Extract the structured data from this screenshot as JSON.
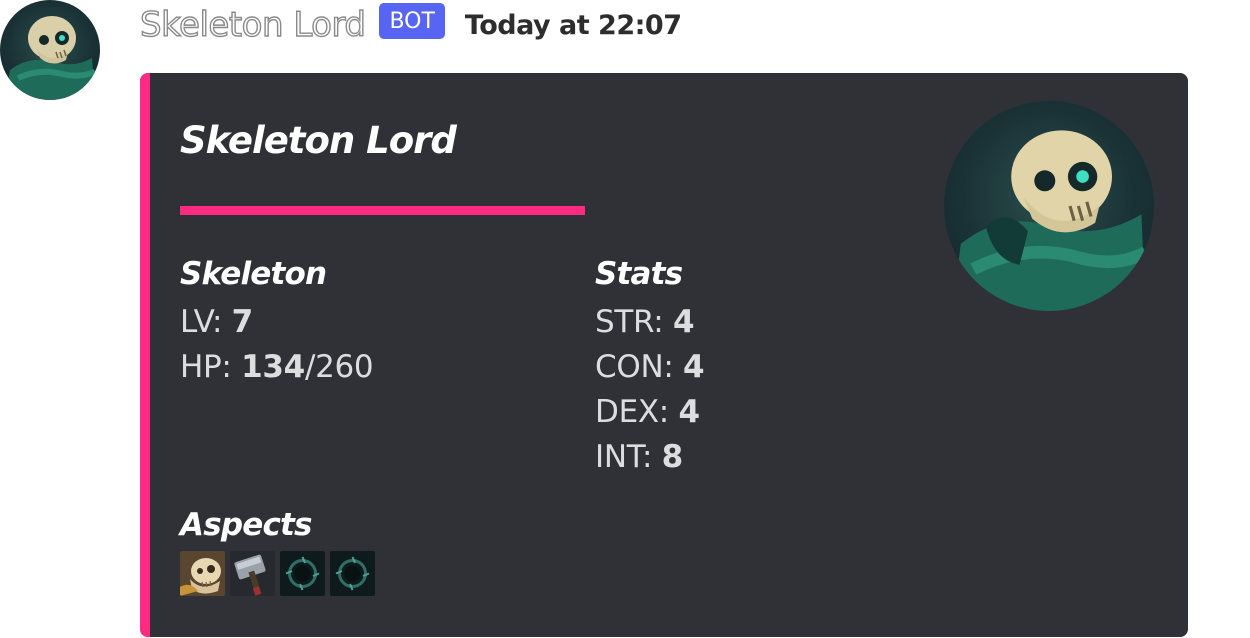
{
  "message": {
    "author": "Skeleton Lord",
    "bot_tag": "BOT",
    "timestamp": "Today at 22:07",
    "avatar_icon": "skull-avatar-icon"
  },
  "embed": {
    "accent_color": "#ff2a82",
    "title": "Skeleton Lord",
    "thumbnail_icon": "skull-thumbnail-icon",
    "fields": {
      "skeleton": {
        "name": "Skeleton",
        "lv_label": "LV:",
        "lv_value": "7",
        "hp_label": "HP:",
        "hp_current": "134",
        "hp_max": "/260"
      },
      "stats": {
        "name": "Stats",
        "str_label": "STR:",
        "str_value": "4",
        "con_label": "CON:",
        "con_value": "4",
        "dex_label": "DEX:",
        "dex_value": "4",
        "int_label": "INT:",
        "int_value": "8"
      },
      "aspects": {
        "name": "Aspects",
        "icons": [
          "skull-aspect-icon",
          "hammer-aspect-icon",
          "void-ring-aspect-icon",
          "void-ring-aspect-icon"
        ]
      }
    }
  }
}
